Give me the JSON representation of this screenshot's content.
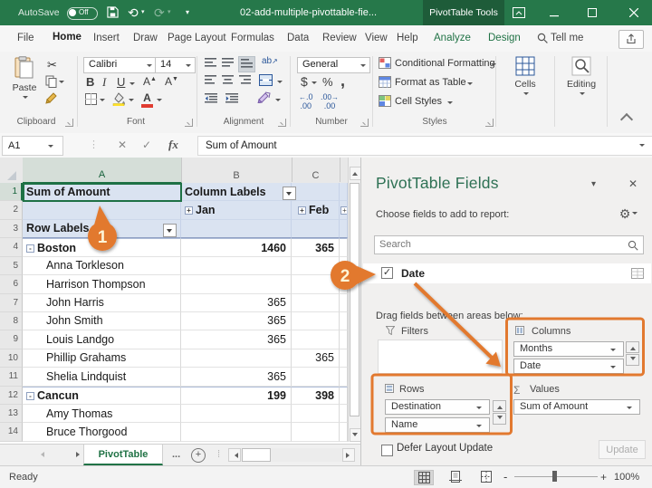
{
  "titlebar": {
    "autosave_label": "AutoSave",
    "autosave_state": "Off",
    "title": "02-add-multiple-pivottable-fie...",
    "context_tab": "PivotTable Tools",
    "minimize": "—",
    "maximize": "□",
    "close": "✕"
  },
  "tabs": [
    {
      "label": "File",
      "type": "plain"
    },
    {
      "label": "Home",
      "type": "active"
    },
    {
      "label": "Insert",
      "type": "plain"
    },
    {
      "label": "Draw",
      "type": "plain"
    },
    {
      "label": "Page Layout",
      "type": "plain"
    },
    {
      "label": "Formulas",
      "type": "plain"
    },
    {
      "label": "Data",
      "type": "plain"
    },
    {
      "label": "Review",
      "type": "plain"
    },
    {
      "label": "View",
      "type": "plain"
    },
    {
      "label": "Help",
      "type": "plain"
    },
    {
      "label": "Analyze",
      "type": "ctx"
    },
    {
      "label": "Design",
      "type": "ctx"
    }
  ],
  "tellme": "Tell me",
  "ribbon": {
    "paste": "Paste",
    "font_name": "Calibri",
    "font_size": "14",
    "bold": "B",
    "italic": "I",
    "underline": "U",
    "number_format": "General",
    "currency": "$",
    "percent": "%",
    "comma": ",",
    "styles_items": [
      "Conditional Formatting",
      "Format as Table",
      "Cell Styles"
    ],
    "cells": "Cells",
    "editing": "Editing",
    "group_labels": [
      "Clipboard",
      "Font",
      "Alignment",
      "Number",
      "Styles"
    ]
  },
  "formula_bar": {
    "name_box": "A1",
    "fx": "fx",
    "formula": "Sum of Amount"
  },
  "sheet": {
    "col_headers": [
      "A",
      "B",
      "C"
    ],
    "rows": [
      {
        "n": 1,
        "a": "Sum of Amount",
        "b": "Column Labels",
        "bold": true,
        "blue": true
      },
      {
        "n": 2,
        "b": "Jan",
        "c": "Feb",
        "bold": true,
        "blue": true
      },
      {
        "n": 3,
        "a": "Row Labels",
        "bold": true,
        "blue": true
      },
      {
        "n": 4,
        "a": "Boston",
        "b": "1460",
        "c": "365",
        "bold": true,
        "btn": "minus",
        "top": true
      },
      {
        "n": 5,
        "a": "Anna Torkleson",
        "ind": 22
      },
      {
        "n": 6,
        "a": "Harrison Thompson",
        "ind": 22
      },
      {
        "n": 7,
        "a": "John Harris",
        "b": "365",
        "ind": 22
      },
      {
        "n": 8,
        "a": "John Smith",
        "b": "365",
        "ind": 22
      },
      {
        "n": 9,
        "a": "Louis Landgo",
        "b": "365",
        "ind": 22
      },
      {
        "n": 10,
        "a": "Phillip Grahams",
        "c": "365",
        "ind": 22
      },
      {
        "n": 11,
        "a": "Shelia Lindquist",
        "b": "365",
        "ind": 22
      },
      {
        "n": 12,
        "a": "Cancun",
        "b": "199",
        "c": "398",
        "bold": true,
        "btn": "minus",
        "top": true
      },
      {
        "n": 13,
        "a": "Amy Thomas",
        "ind": 22
      },
      {
        "n": 14,
        "a": "Bruce Thorgood",
        "ind": 22
      }
    ],
    "expand_symbol": "+",
    "collapse_symbol": "-"
  },
  "tabsbar": {
    "sheet_name": "PivotTable",
    "more": "...",
    "add": "+"
  },
  "status": {
    "ready": "Ready",
    "zoom": "100%",
    "zoom_out": "-",
    "zoom_in": "+"
  },
  "panel": {
    "title": "PivotTable Fields",
    "options_icon": "▾",
    "close_icon": "✕",
    "choose": "Choose fields to add to report:",
    "gear": "⚙",
    "search_placeholder": "Search",
    "field": {
      "label": "Date",
      "checked": "✓"
    },
    "drag": "Drag fields between areas below:",
    "areas": {
      "filters": {
        "label": "Filters",
        "pills": []
      },
      "columns": {
        "label": "Columns",
        "pills": [
          "Months",
          "Date"
        ]
      },
      "rows": {
        "label": "Rows",
        "pills": [
          "Destination",
          "Name"
        ]
      },
      "values": {
        "label": "Values",
        "sigma": "Σ",
        "pills": [
          "Sum of Amount"
        ]
      }
    },
    "defer": "Defer Layout Update",
    "update": "Update"
  },
  "annotations": {
    "step1": "1",
    "step2": "2",
    "color": "#e2792f"
  }
}
